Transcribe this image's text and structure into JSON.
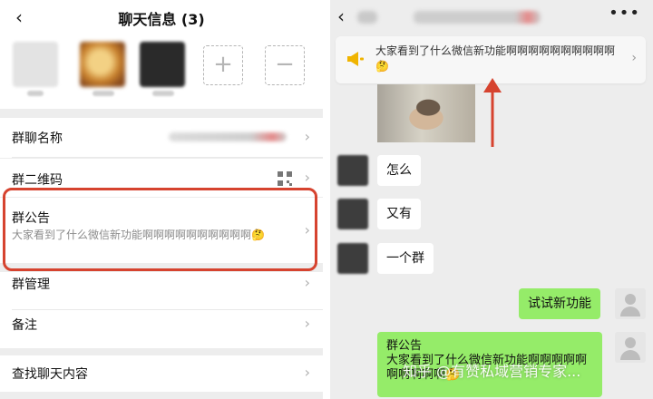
{
  "left": {
    "back_glyph": "‹",
    "title": "聊天信息 (3)",
    "add_glyph": "+",
    "remove_glyph": "−",
    "rows": {
      "group_name": "群聊名称",
      "group_qr": "群二维码",
      "announcement": "群公告",
      "announcement_text": "大家看到了什么微信新功能啊啊啊啊啊啊啊啊啊啊🤔",
      "group_manage": "群管理",
      "remark": "备注",
      "find_chat": "查找聊天内容"
    },
    "chevron": "›",
    "highlight_color": "#d6432f"
  },
  "right": {
    "back_glyph": "‹",
    "more_glyph": "•••",
    "pinned_banner": {
      "text": "大家看到了什么微信新功能啊啊啊啊啊啊啊啊啊啊🤔",
      "chevron": "›",
      "icon": "speaker-icon"
    },
    "arrow_color": "#d6432f",
    "messages": [
      {
        "side": "in",
        "text": "怎么"
      },
      {
        "side": "in",
        "text": "又有"
      },
      {
        "side": "in",
        "text": "一个群"
      },
      {
        "side": "out",
        "text": "试试新功能"
      }
    ],
    "announcement_card": {
      "title": "群公告",
      "text": "大家看到了什么微信新功能啊啊啊啊啊啊啊啊啊啊🤔"
    },
    "watermark": "知乎 @有赞私域营销专家..."
  },
  "colors": {
    "wechat_green": "#95ec69",
    "announcement_icon": "#f0b400"
  }
}
